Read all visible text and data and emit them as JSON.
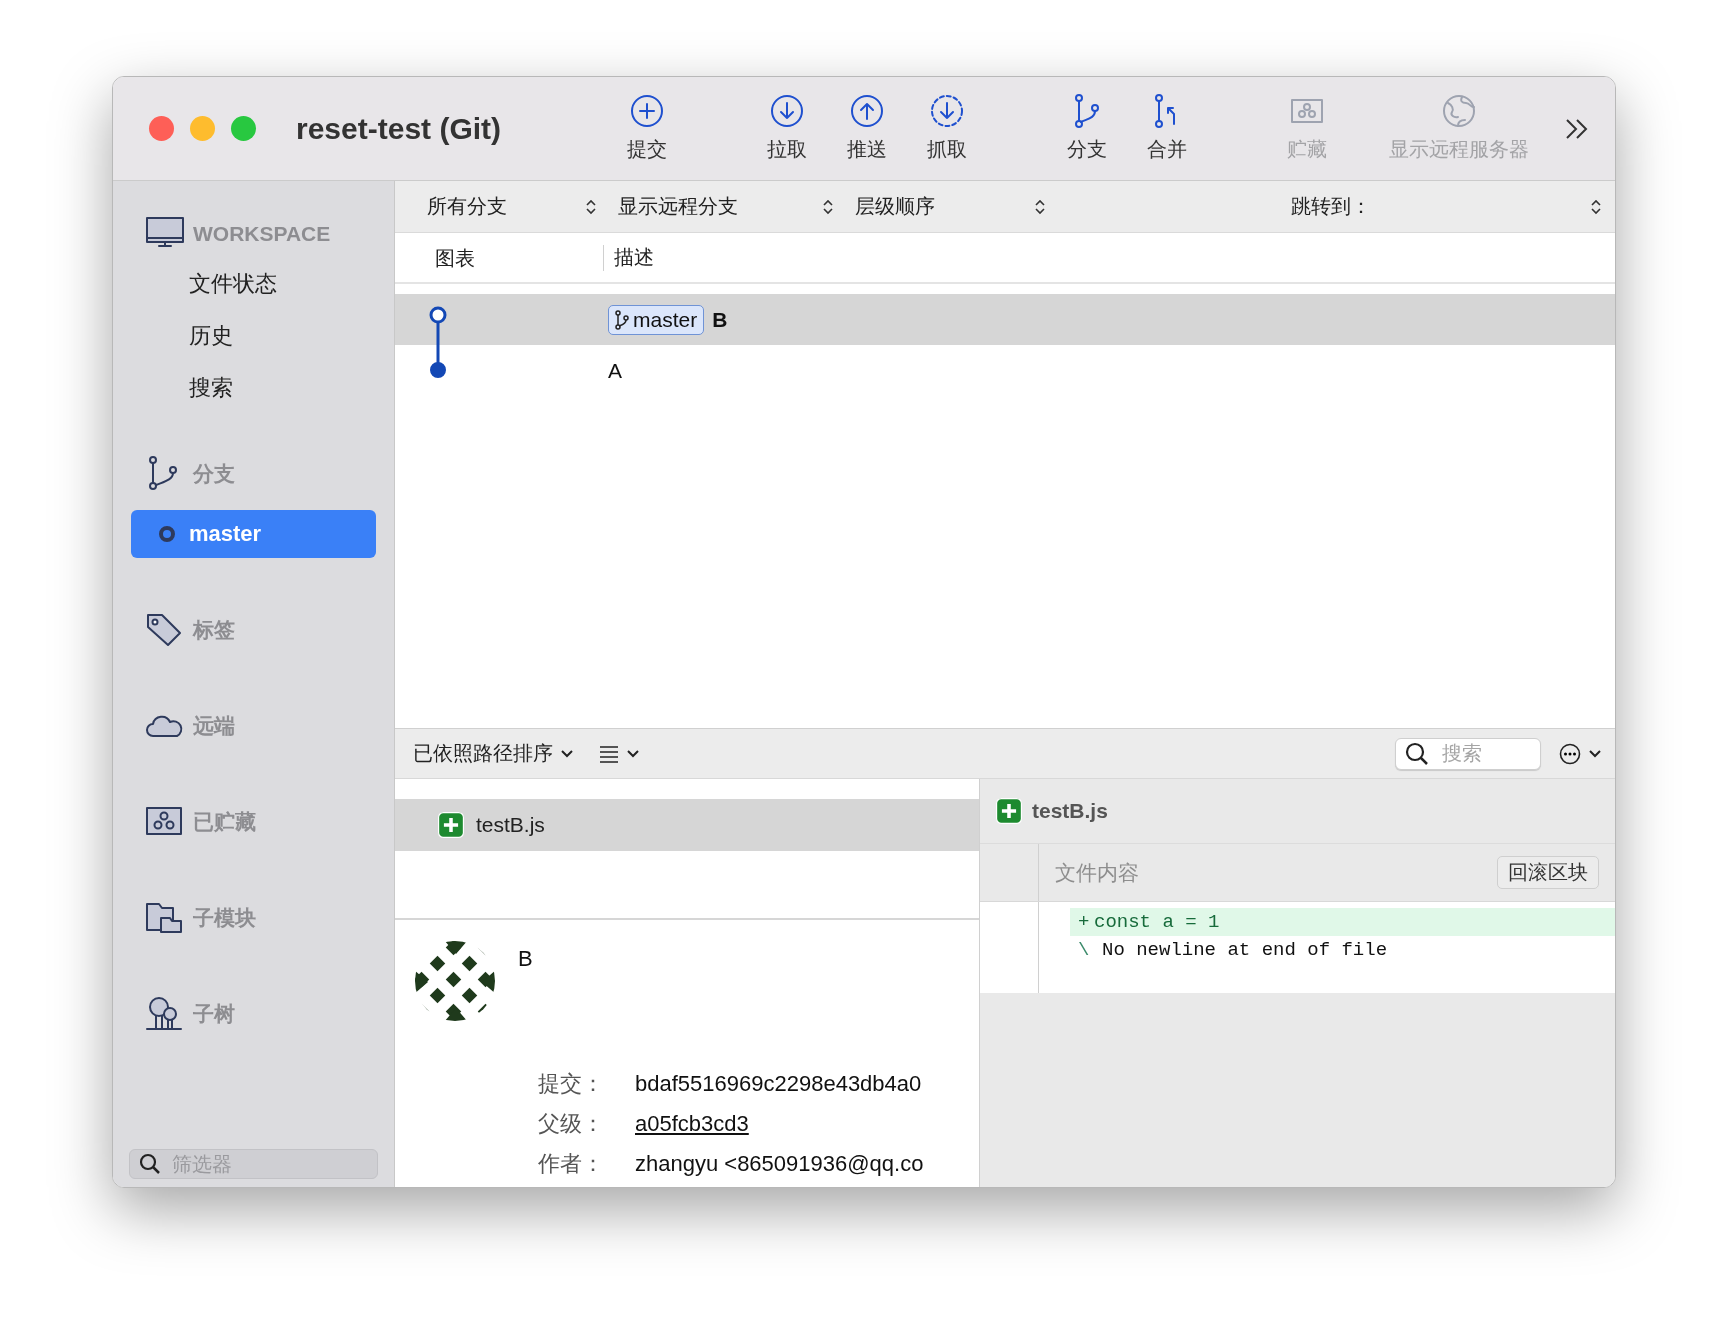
{
  "window": {
    "title": "reset-test (Git)"
  },
  "toolbar": [
    {
      "kind": "commit",
      "label": "提交",
      "disabled": false
    },
    {
      "kind": "pull",
      "label": "拉取",
      "disabled": false
    },
    {
      "kind": "push",
      "label": "推送",
      "disabled": false
    },
    {
      "kind": "fetch",
      "label": "抓取",
      "disabled": false
    },
    {
      "kind": "branch",
      "label": "分支",
      "disabled": false
    },
    {
      "kind": "merge",
      "label": "合并",
      "disabled": false
    },
    {
      "kind": "stash",
      "label": "贮藏",
      "disabled": true
    },
    {
      "kind": "remote",
      "label": "显示远程服务器",
      "disabled": true
    }
  ],
  "sidebar": {
    "sections": [
      {
        "kind": "workspace",
        "label": "WORKSPACE",
        "items": [
          {
            "label": "文件状态",
            "selected": false
          },
          {
            "label": "历史",
            "selected": false
          },
          {
            "label": "搜索",
            "selected": false
          }
        ]
      },
      {
        "kind": "branches",
        "label": "分支",
        "items": [
          {
            "label": "master",
            "selected": true
          }
        ]
      },
      {
        "kind": "tags",
        "label": "标签"
      },
      {
        "kind": "remotes",
        "label": "远端"
      },
      {
        "kind": "stashes",
        "label": "已贮藏"
      },
      {
        "kind": "submodules",
        "label": "子模块"
      },
      {
        "kind": "subtrees",
        "label": "子树"
      }
    ],
    "filter": {
      "placeholder": "筛选器"
    }
  },
  "branch_filter": {
    "dropdowns": [
      {
        "label": "所有分支"
      },
      {
        "label": "显示远程分支"
      },
      {
        "label": "层级顺序"
      }
    ],
    "jump_to": {
      "label": "跳转到："
    }
  },
  "commit_table": {
    "columns": [
      "图表",
      "描述"
    ],
    "rows": [
      {
        "message": "B",
        "branch": "master",
        "checked_out": true,
        "selected": true
      },
      {
        "message": "A",
        "checked_out": false,
        "selected": false
      }
    ]
  },
  "files_toolbar": {
    "sort_label": "已依照路径排序",
    "search": {
      "placeholder": "搜索"
    }
  },
  "files": [
    {
      "name": "testB.js",
      "kind": "added",
      "selected": true
    }
  ],
  "commit_details": {
    "message": "B",
    "fields": [
      {
        "label": "提交：",
        "value": "bdaf5516969c2298e43db4a0",
        "kind": "text"
      },
      {
        "label": "父级：",
        "value": "a05fcb3cd3",
        "kind": "link"
      },
      {
        "label": "作者：",
        "value": "zhangyu <865091936@qq.co",
        "kind": "text"
      }
    ]
  },
  "diff": {
    "file": "testB.js",
    "kind": "added",
    "hunk": {
      "title": "文件内容",
      "button": "回滚区块"
    },
    "lines": [
      {
        "kind": "added",
        "sign": "+",
        "text": "const a = 1"
      },
      {
        "kind": "note",
        "sign": "\\",
        "text": "No newline at end of file"
      }
    ]
  }
}
